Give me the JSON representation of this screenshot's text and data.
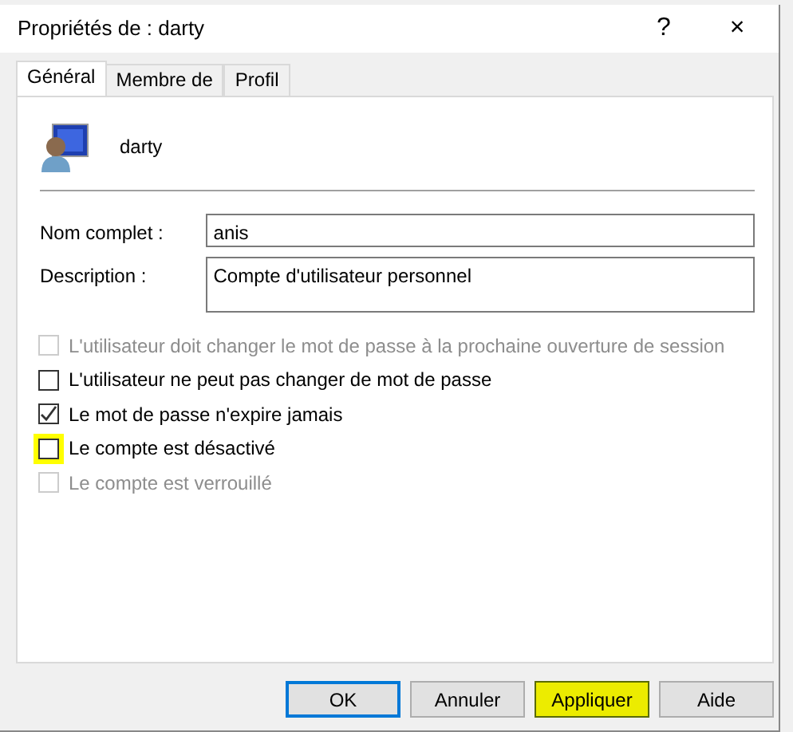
{
  "window": {
    "title": "Propriétés de : darty",
    "help": "?",
    "close": "×"
  },
  "tabs": [
    {
      "label": "Général",
      "selected": true
    },
    {
      "label": "Membre de",
      "selected": false
    },
    {
      "label": "Profil",
      "selected": false
    }
  ],
  "user": {
    "name": "darty"
  },
  "fields": [
    {
      "label": "Nom complet :",
      "value": "anis",
      "kind": "line"
    },
    {
      "label": "Description :",
      "value": "Compte d'utilisateur personnel",
      "kind": "area"
    }
  ],
  "checkboxes": [
    {
      "label": "L'utilisateur doit changer le mot de passe à la prochaine ouverture de session",
      "checked": false,
      "disabled": true,
      "highlighted": false
    },
    {
      "label": "L'utilisateur ne peut pas changer de mot de passe",
      "checked": false,
      "disabled": false,
      "highlighted": false
    },
    {
      "label": "Le mot de passe n'expire jamais",
      "checked": true,
      "disabled": false,
      "highlighted": false
    },
    {
      "label": "Le compte est désactivé",
      "checked": false,
      "disabled": false,
      "highlighted": true
    },
    {
      "label": "Le compte est verrouillé",
      "checked": false,
      "disabled": true,
      "highlighted": false
    }
  ],
  "buttons": [
    {
      "label": "OK",
      "default": true,
      "highlighted": false
    },
    {
      "label": "Annuler",
      "default": false,
      "highlighted": false
    },
    {
      "label": "Appliquer",
      "default": false,
      "highlighted": true
    },
    {
      "label": "Aide",
      "default": false,
      "highlighted": false
    }
  ]
}
